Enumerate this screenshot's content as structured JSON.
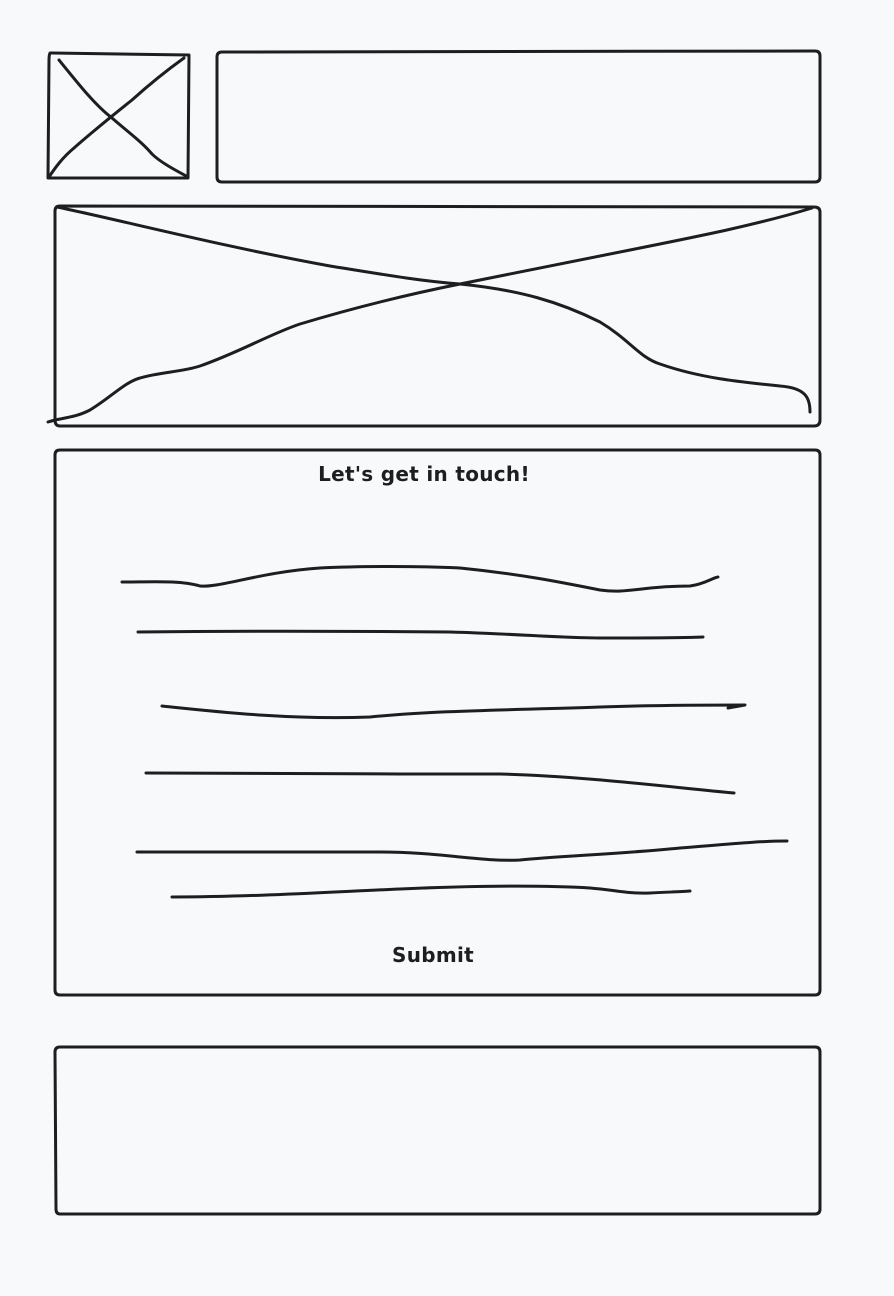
{
  "contact_form": {
    "heading": "Let's get in touch!",
    "submit_label": "Submit"
  },
  "colors": {
    "background": "#f8f9fb",
    "stroke": "#1e1e1e"
  }
}
